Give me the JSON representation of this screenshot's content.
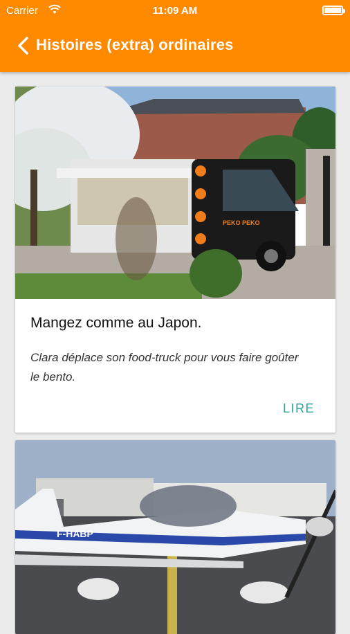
{
  "status_bar": {
    "carrier": "Carrier",
    "time": "11:09 AM"
  },
  "header": {
    "title": "Histoires (extra) ordinaires",
    "background": "#ff8a00"
  },
  "cards": [
    {
      "image": "food-truck-photo",
      "image_sign_text": "PEKO PEKO",
      "title": "Mangez comme au Japon.",
      "description": "Clara déplace son food-truck pour vous faire goûter le bento.",
      "action": "LIRE",
      "action_color": "#26a69a"
    },
    {
      "image": "small-airplane-photo",
      "image_registration_text": "F-HABP"
    }
  ]
}
